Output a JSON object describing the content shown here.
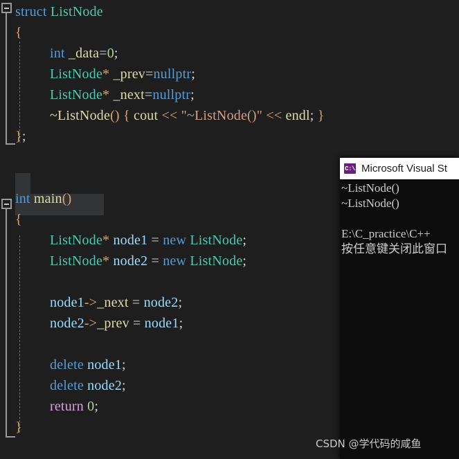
{
  "editor": {
    "background_color": "#1e1e1e",
    "language": "cpp",
    "code_lines": [
      {
        "indent": 0,
        "tokens": [
          {
            "text": "struct ",
            "kind": "keyword"
          },
          {
            "text": "ListNode",
            "kind": "type"
          }
        ]
      },
      {
        "indent": 1,
        "tokens": [
          {
            "text": "{",
            "kind": "brace"
          }
        ]
      },
      {
        "indent": 2,
        "tokens": [
          {
            "text": "int",
            "kind": "keyword"
          },
          {
            "text": " _data",
            "kind": "plain"
          },
          {
            "text": "=",
            "kind": "op"
          },
          {
            "text": "0",
            "kind": "number"
          },
          {
            "text": ";",
            "kind": "punct"
          }
        ]
      },
      {
        "indent": 2,
        "tokens": [
          {
            "text": "ListNode",
            "kind": "type"
          },
          {
            "text": "*",
            "kind": "brace"
          },
          {
            "text": " _prev",
            "kind": "plain"
          },
          {
            "text": "=",
            "kind": "op"
          },
          {
            "text": "nullptr",
            "kind": "keyword"
          },
          {
            "text": ";",
            "kind": "punct"
          }
        ]
      },
      {
        "indent": 2,
        "tokens": [
          {
            "text": "ListNode",
            "kind": "type"
          },
          {
            "text": "*",
            "kind": "brace"
          },
          {
            "text": " _next",
            "kind": "plain"
          },
          {
            "text": "=",
            "kind": "op"
          },
          {
            "text": "nullptr",
            "kind": "keyword"
          },
          {
            "text": ";",
            "kind": "punct"
          }
        ]
      },
      {
        "indent": 2,
        "tokens": [
          {
            "text": "~ListNode",
            "kind": "plain"
          },
          {
            "text": "()",
            "kind": "brace"
          },
          {
            "text": " ",
            "kind": "plain"
          },
          {
            "text": "{",
            "kind": "brace"
          },
          {
            "text": " cout ",
            "kind": "plain"
          },
          {
            "text": "<<",
            "kind": "brace"
          },
          {
            "text": " ",
            "kind": "plain"
          },
          {
            "text": "\"~ListNode()\"",
            "kind": "string"
          },
          {
            "text": " ",
            "kind": "plain"
          },
          {
            "text": "<<",
            "kind": "brace"
          },
          {
            "text": " endl",
            "kind": "plain"
          },
          {
            "text": ";",
            "kind": "punct"
          },
          {
            "text": " ",
            "kind": "plain"
          },
          {
            "text": "}",
            "kind": "brace"
          }
        ]
      },
      {
        "indent": 1,
        "tokens": [
          {
            "text": "}",
            "kind": "brace"
          },
          {
            "text": ";",
            "kind": "punct"
          }
        ]
      },
      {
        "indent": 0,
        "tokens": []
      },
      {
        "indent": 0,
        "tokens": []
      },
      {
        "indent": 0,
        "tokens": [
          {
            "text": "int ",
            "kind": "keyword"
          },
          {
            "text": "main",
            "kind": "plain"
          },
          {
            "text": "()",
            "kind": "brace"
          }
        ]
      },
      {
        "indent": 1,
        "tokens": [
          {
            "text": "{",
            "kind": "brace"
          }
        ]
      },
      {
        "indent": 2,
        "tokens": [
          {
            "text": "ListNode",
            "kind": "type"
          },
          {
            "text": "*",
            "kind": "brace"
          },
          {
            "text": " ",
            "kind": "plain"
          },
          {
            "text": "node1",
            "kind": "ident"
          },
          {
            "text": " = ",
            "kind": "op"
          },
          {
            "text": "new",
            "kind": "keyword"
          },
          {
            "text": " ",
            "kind": "plain"
          },
          {
            "text": "ListNode",
            "kind": "type"
          },
          {
            "text": ";",
            "kind": "punct"
          }
        ]
      },
      {
        "indent": 2,
        "tokens": [
          {
            "text": "ListNode",
            "kind": "type"
          },
          {
            "text": "*",
            "kind": "brace"
          },
          {
            "text": " ",
            "kind": "plain"
          },
          {
            "text": "node2",
            "kind": "ident"
          },
          {
            "text": " = ",
            "kind": "op"
          },
          {
            "text": "new",
            "kind": "keyword"
          },
          {
            "text": " ",
            "kind": "plain"
          },
          {
            "text": "ListNode",
            "kind": "type"
          },
          {
            "text": ";",
            "kind": "punct"
          }
        ]
      },
      {
        "indent": 2,
        "tokens": []
      },
      {
        "indent": 2,
        "tokens": [
          {
            "text": "node1",
            "kind": "ident"
          },
          {
            "text": "->",
            "kind": "brace"
          },
          {
            "text": "_next",
            "kind": "plain"
          },
          {
            "text": " = ",
            "kind": "op"
          },
          {
            "text": "node2",
            "kind": "ident"
          },
          {
            "text": ";",
            "kind": "punct"
          }
        ]
      },
      {
        "indent": 2,
        "tokens": [
          {
            "text": "node2",
            "kind": "ident"
          },
          {
            "text": "->",
            "kind": "brace"
          },
          {
            "text": "_prev",
            "kind": "plain"
          },
          {
            "text": " = ",
            "kind": "op"
          },
          {
            "text": "node1",
            "kind": "ident"
          },
          {
            "text": ";",
            "kind": "punct"
          }
        ]
      },
      {
        "indent": 2,
        "tokens": []
      },
      {
        "indent": 2,
        "tokens": [
          {
            "text": "delete",
            "kind": "keyword"
          },
          {
            "text": " ",
            "kind": "plain"
          },
          {
            "text": "node1",
            "kind": "ident"
          },
          {
            "text": ";",
            "kind": "punct"
          }
        ]
      },
      {
        "indent": 2,
        "tokens": [
          {
            "text": "delete",
            "kind": "keyword"
          },
          {
            "text": " ",
            "kind": "plain"
          },
          {
            "text": "node2",
            "kind": "ident"
          },
          {
            "text": ";",
            "kind": "punct"
          }
        ]
      },
      {
        "indent": 2,
        "tokens": [
          {
            "text": "return",
            "kind": "ctrl"
          },
          {
            "text": " ",
            "kind": "plain"
          },
          {
            "text": "0",
            "kind": "number"
          },
          {
            "text": ";",
            "kind": "punct"
          }
        ]
      },
      {
        "indent": 1,
        "tokens": [
          {
            "text": "}",
            "kind": "brace"
          }
        ]
      }
    ],
    "selected_line_index": 9,
    "collapse_icon_name": "collapse-minus-icon"
  },
  "console": {
    "icon_label": "C:\\",
    "title": "Microsoft Visual St",
    "background_color": "#0c0c0c",
    "lines": [
      "~ListNode()",
      "~ListNode()",
      "",
      "E:\\C_practice\\C++",
      "按任意键关闭此窗口"
    ]
  },
  "watermark": {
    "text": "CSDN @学代码的咸鱼"
  }
}
